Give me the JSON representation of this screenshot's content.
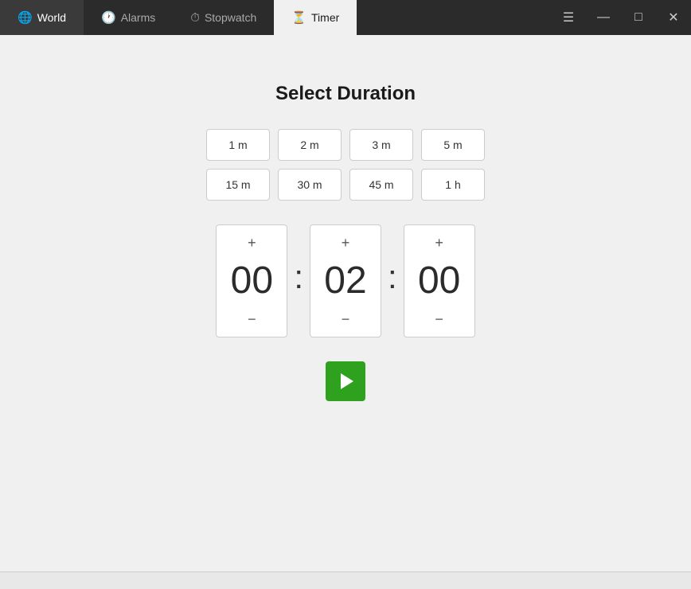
{
  "titlebar": {
    "tabs": [
      {
        "id": "world",
        "label": "World",
        "icon": "🌐",
        "active": false
      },
      {
        "id": "alarms",
        "label": "Alarms",
        "icon": "🕐",
        "active": false
      },
      {
        "id": "stopwatch",
        "label": "Stopwatch",
        "icon": "⏱",
        "active": false
      },
      {
        "id": "timer",
        "label": "Timer",
        "icon": "⏳",
        "active": true
      }
    ],
    "window_controls": {
      "menu_label": "☰",
      "minimize_label": "—",
      "maximize_label": "□",
      "close_label": "✕"
    }
  },
  "main": {
    "title": "Select Duration",
    "duration_buttons": [
      {
        "label": "1 m"
      },
      {
        "label": "2 m"
      },
      {
        "label": "3 m"
      },
      {
        "label": "5 m"
      },
      {
        "label": "15 m"
      },
      {
        "label": "30 m"
      },
      {
        "label": "45 m"
      },
      {
        "label": "1 h"
      }
    ],
    "time": {
      "hours": "00",
      "minutes": "02",
      "seconds": "00"
    }
  },
  "colors": {
    "play_button_bg": "#2ea11e",
    "titlebar_bg": "#2b2b2b",
    "active_tab_bg": "#f0f0f0"
  }
}
